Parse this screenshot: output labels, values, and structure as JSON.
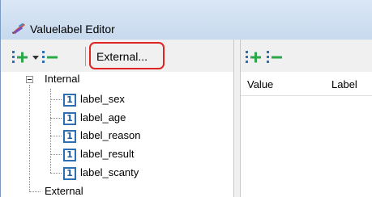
{
  "window": {
    "title": "Valuelabel Editor",
    "app_icon": "pencil-ruler-icon"
  },
  "toolbar": {
    "add_icon": "add-tree-icon",
    "dropdown_icon": "dropdown-arrow-icon",
    "remove_icon": "remove-tree-icon",
    "external_label": "External..."
  },
  "right_toolbar": {
    "add_icon": "add-tree-icon",
    "remove_icon": "remove-tree-icon"
  },
  "tree": {
    "root_internal": "Internal",
    "items": [
      {
        "label": "label_sex",
        "icon_glyph": "1"
      },
      {
        "label": "label_age",
        "icon_glyph": "1"
      },
      {
        "label": "label_reason",
        "icon_glyph": "1"
      },
      {
        "label": "label_result",
        "icon_glyph": "1"
      },
      {
        "label": "label_scanty",
        "icon_glyph": "1"
      }
    ],
    "root_external": "External"
  },
  "table": {
    "columns": [
      "Value",
      "Label"
    ]
  },
  "colors": {
    "highlight_outline": "#e02424",
    "icon_green": "#2aa84a",
    "icon_blue": "#2d6fb3"
  }
}
